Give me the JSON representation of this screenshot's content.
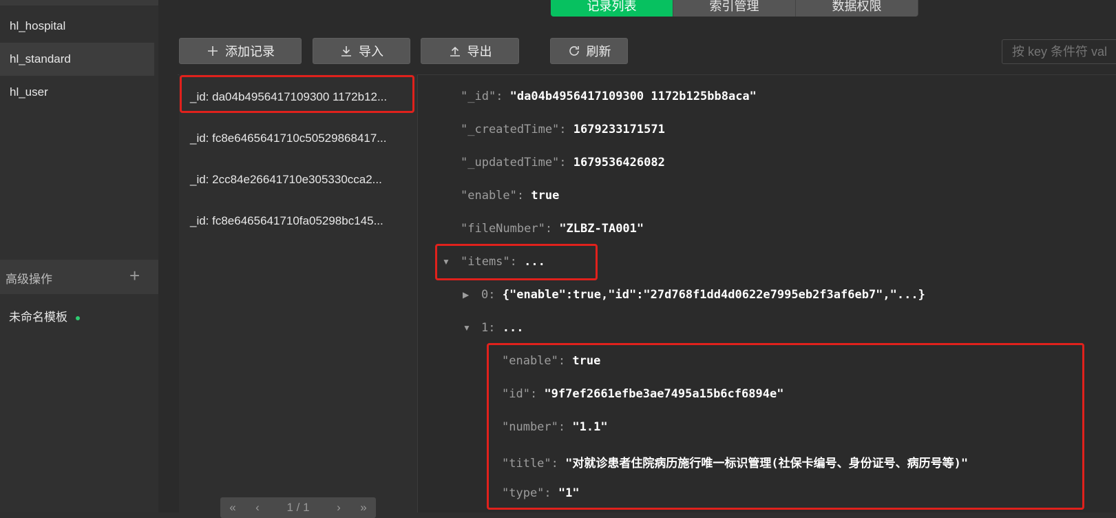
{
  "sidebar": {
    "collections": [
      "hl_hospital",
      "hl_standard",
      "hl_user"
    ],
    "active": "hl_standard",
    "advanced_label": "高级操作",
    "template_label": "未命名模板"
  },
  "tabs": [
    "记录列表",
    "索引管理",
    "数据权限"
  ],
  "toolbar": {
    "add_label": "添加记录",
    "import_label": "导入",
    "export_label": "导出",
    "refresh_label": "刷新"
  },
  "search": {
    "placeholder": "按 key 条件符 val"
  },
  "records": [
    "_id: da04b4956417109300 1172b12...",
    "_id: fc8e6465641710c50529868417...",
    "_id: 2cc84e26641710e305330cca2...",
    "_id: fc8e6465641710fa05298bc145..."
  ],
  "pager": {
    "text": "1 / 1"
  },
  "document": {
    "fields": [
      {
        "key": "\"_id\"",
        "value": "\"da04b4956417109300 1172b125bb8aca\""
      },
      {
        "key": "\"_createdTime\"",
        "value": "1679233171571"
      },
      {
        "key": "\"_updatedTime\"",
        "value": "1679536426082"
      },
      {
        "key": "\"enable\"",
        "value": "true"
      },
      {
        "key": "\"fileNumber\"",
        "value": "\"ZLBZ-TA001\""
      },
      {
        "key": "\"items\"",
        "value": "..."
      }
    ],
    "item0_key": "0",
    "item0_value": "{\"enable\":true,\"id\":\"27d768f1dd4d0622e7995eb2f3af6eb7\",\"...}",
    "item1_key": "1",
    "item1_value": "...",
    "item1_fields": [
      {
        "key": "\"enable\"",
        "value": "true"
      },
      {
        "key": "\"id\"",
        "value": "\"9f7ef2661efbe3ae7495a15b6cf6894e\""
      },
      {
        "key": "\"number\"",
        "value": "\"1.1\""
      },
      {
        "key": "\"title\"",
        "value": "\"对就诊患者住院病历施行唯一标识管理(社保卡编号、身份证号、病历号等)\""
      },
      {
        "key": "\"type\"",
        "value": "\"1\""
      }
    ]
  },
  "colors": {
    "accent": "#07c160",
    "highlight": "#e0211c"
  }
}
